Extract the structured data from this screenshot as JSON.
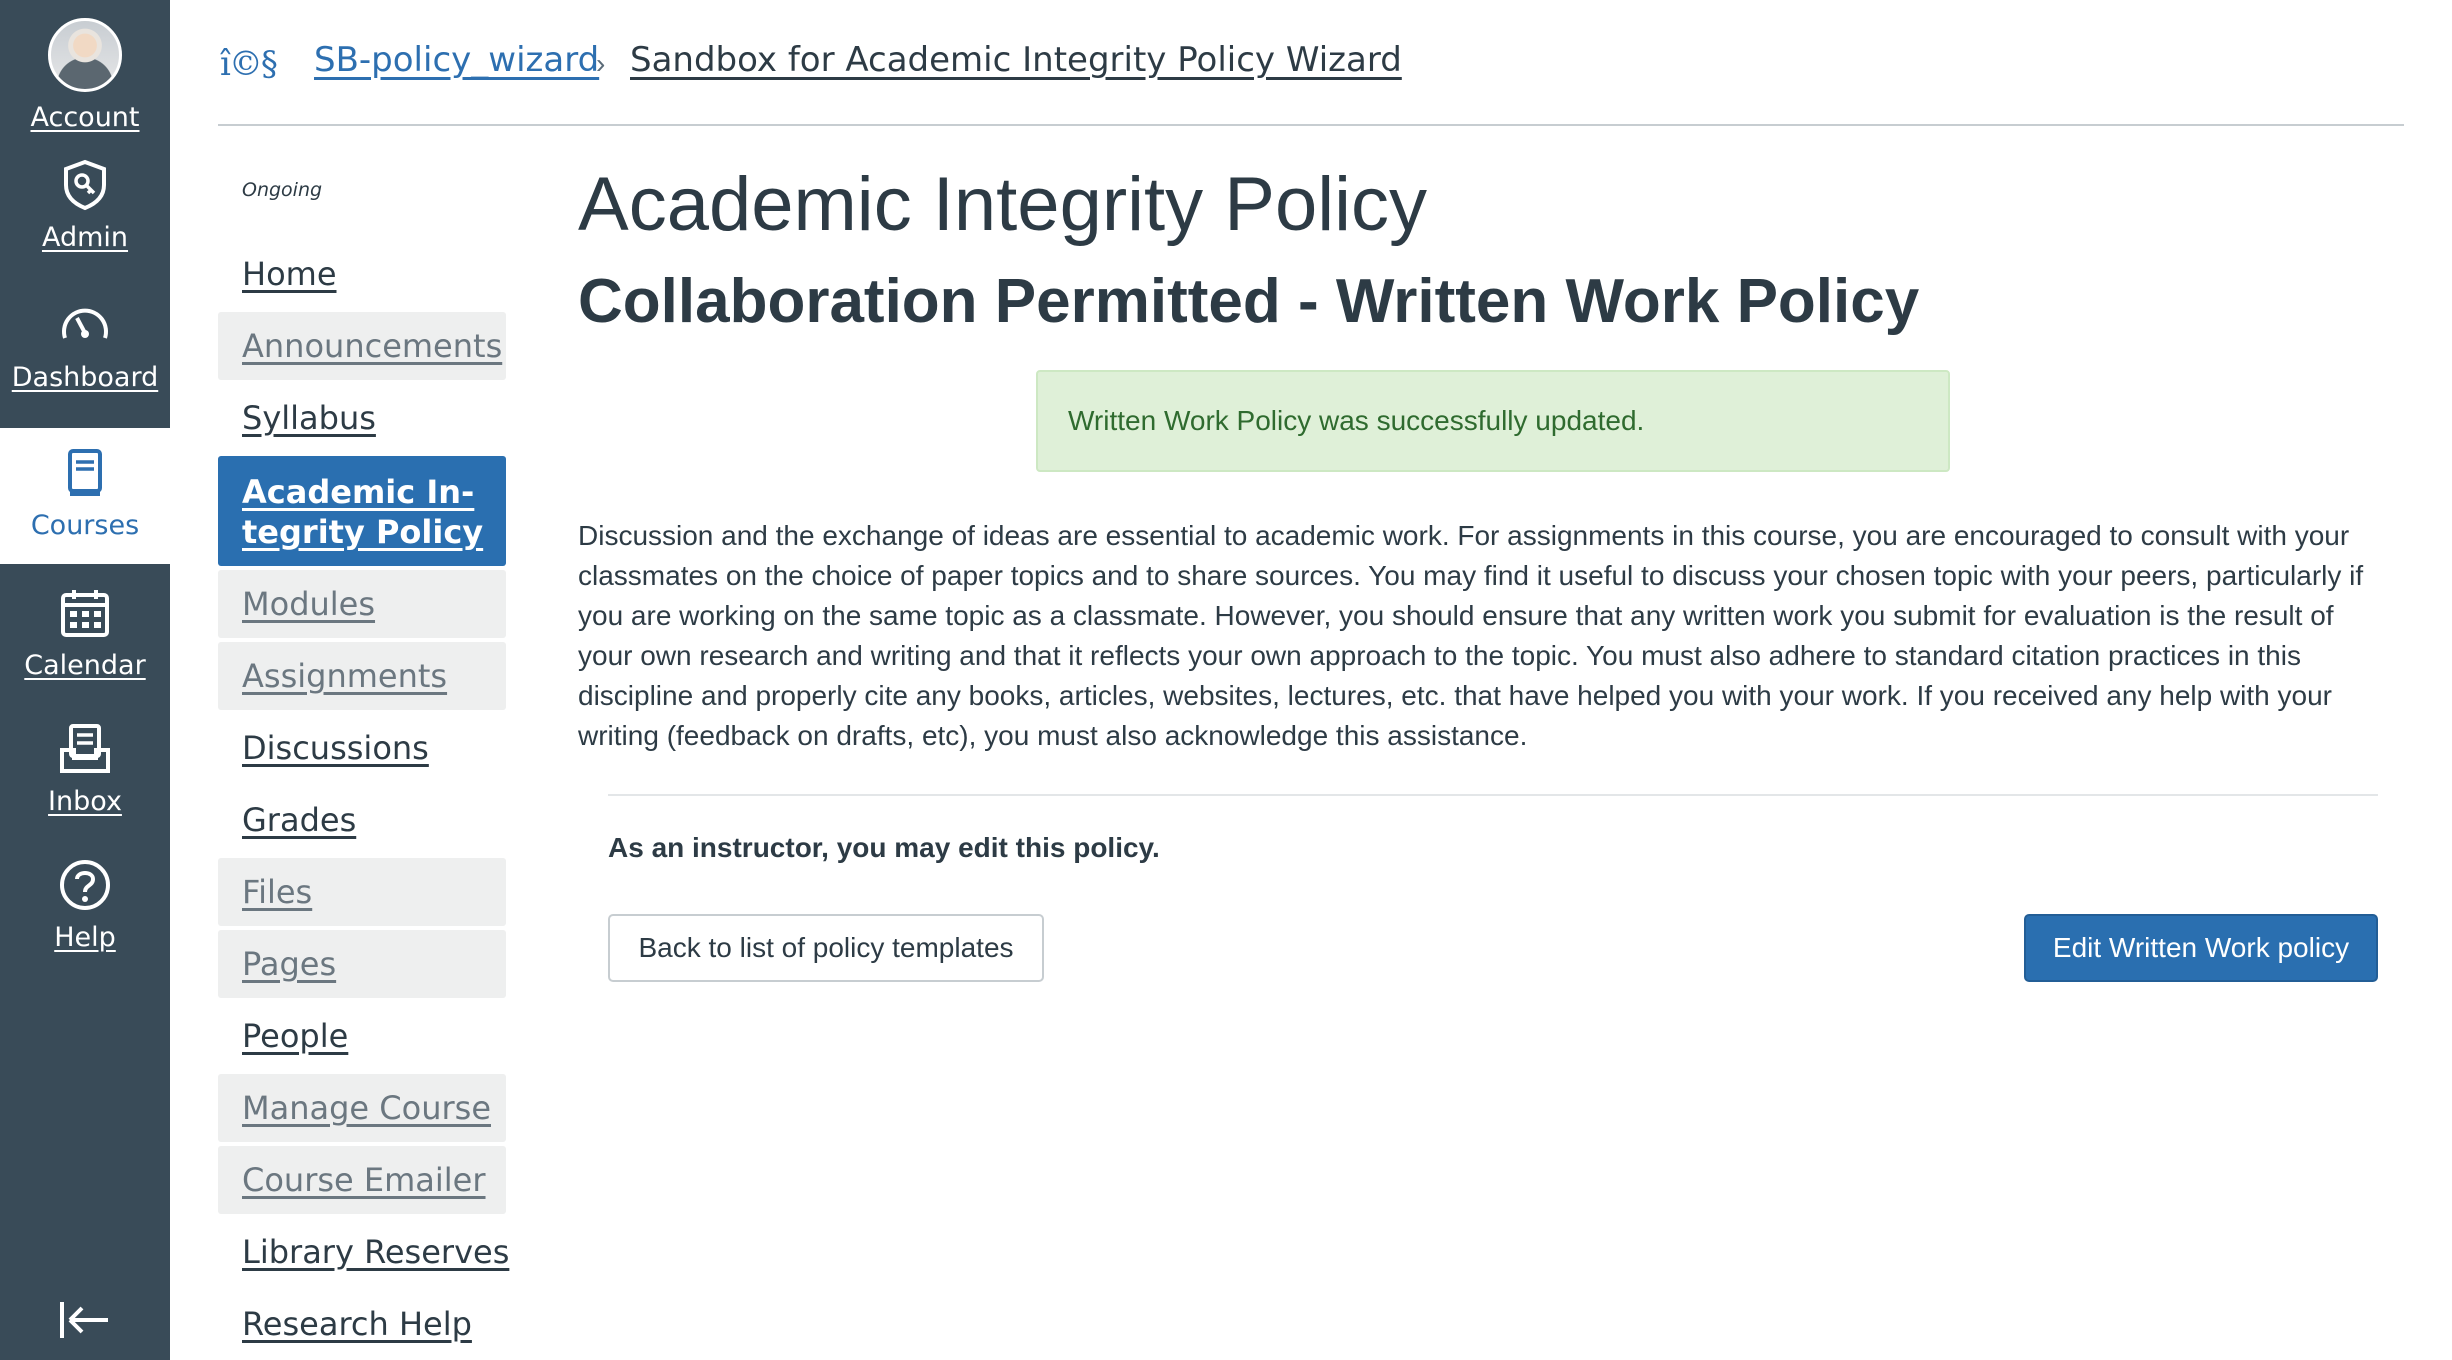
{
  "global_nav": {
    "items": [
      {
        "label": "Account",
        "icon": "avatar"
      },
      {
        "label": "Admin",
        "icon": "shield-key-icon"
      },
      {
        "label": "Dashboard",
        "icon": "speedometer-icon"
      },
      {
        "label": "Courses",
        "icon": "book-icon",
        "active": true
      },
      {
        "label": "Calendar",
        "icon": "calendar-icon"
      },
      {
        "label": "Inbox",
        "icon": "inbox-icon"
      },
      {
        "label": "Help",
        "icon": "help-circle-icon"
      }
    ],
    "collapse_icon": "collapse-arrow-icon",
    "colors": {
      "background": "#394b58",
      "active": "#2d6fb0"
    }
  },
  "breadcrumb": {
    "logo_text": "î©§",
    "course_code": "SB-policy_wizard",
    "separator": "›",
    "page": "Sandbox for Academic Integrity Policy Wizard"
  },
  "course_nav": {
    "term": "Ongoing",
    "items": [
      {
        "label": "Home",
        "style": "normal"
      },
      {
        "label": "Announcements",
        "style": "gray"
      },
      {
        "label": "Syllabus",
        "style": "normal"
      },
      {
        "label": "Academic In-tegrity Policy",
        "style": "active"
      },
      {
        "label": "Modules",
        "style": "gray"
      },
      {
        "label": "Assignments",
        "style": "gray"
      },
      {
        "label": "Discussions",
        "style": "normal"
      },
      {
        "label": "Grades",
        "style": "normal"
      },
      {
        "label": "Files",
        "style": "gray"
      },
      {
        "label": "Pages",
        "style": "gray"
      },
      {
        "label": "People",
        "style": "normal"
      },
      {
        "label": "Manage Course",
        "style": "gray"
      },
      {
        "label": "Course Emailer",
        "style": "gray"
      },
      {
        "label": "Library Reserves",
        "style": "normal"
      },
      {
        "label": "Research Help",
        "style": "normal"
      }
    ]
  },
  "main": {
    "page_title": "Academic Integrity Policy",
    "policy_title": "Collaboration Permitted - Written Work Policy",
    "alert": "Written Work Policy was successfully updated.",
    "policy_text": "Discussion and the exchange of ideas are essential to academic work. For assignments in this course, you are encouraged to consult with your classmates on the choice of paper topics and to share sources. You may find it useful to discuss your chosen topic with your peers, particularly if you are working on the same topic as a classmate. However, you should ensure that any written work you submit for evaluation is the result of your own research and writing and that it reflects your own approach to the topic. You must also adhere to standard citation practices in this discipline and properly cite any books, articles, websites, lectures, etc. that have helped you with your work. If you received any help with your writing (feedback on drafts, etc), you must also acknowledge this assistance.",
    "instructor_note": "As an instructor, you may edit this policy.",
    "back_button": "Back to list of policy templates",
    "edit_button": "Edit Written Work policy"
  }
}
